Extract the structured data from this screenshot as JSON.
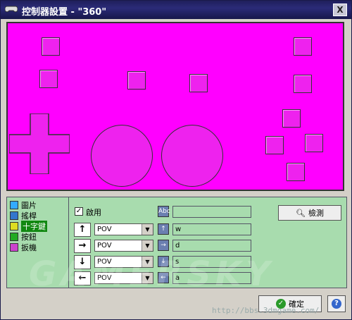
{
  "window": {
    "title": "控制器設置 - \"360\"",
    "close_label": "X"
  },
  "tree": {
    "items": [
      {
        "label": "圖片",
        "color": "#33aaff"
      },
      {
        "label": "搖桿",
        "color": "#3377cc"
      },
      {
        "label": "十字鍵",
        "color": "#dddd22",
        "selected": true
      },
      {
        "label": "按鈕",
        "color": "#22aa22"
      },
      {
        "label": "扳機",
        "color": "#cc44cc"
      }
    ]
  },
  "config": {
    "enable_label": "啟用",
    "enable_checked": "✓",
    "name_icon": "Abc",
    "name_value": "",
    "rows": [
      {
        "arrow": "↑",
        "source": "POV",
        "key": "w"
      },
      {
        "arrow": "→",
        "source": "POV",
        "key": "d"
      },
      {
        "arrow": "↓",
        "source": "POV",
        "key": "s"
      },
      {
        "arrow": "←",
        "source": "POV",
        "key": "a"
      }
    ],
    "detect_label": "檢測"
  },
  "footer": {
    "ok_label": "確定",
    "help_label": "?"
  },
  "watermark": "GAMERSKY",
  "url": "http://bbs.3dmgame.com/",
  "colors": {
    "canvas": "#ff00ff",
    "panel": "#a8dcae",
    "title_bar": "#1f1f5c"
  }
}
